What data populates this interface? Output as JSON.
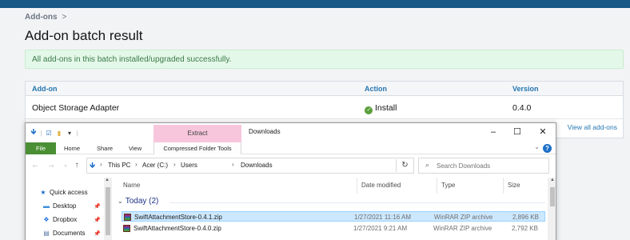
{
  "page": {
    "breadcrumb": "Add-ons",
    "breadcrumb_sep": ">",
    "title": "Add-on batch result",
    "success_message": "All add-ons in this batch installed/upgraded successfully.",
    "table": {
      "headers": {
        "addon": "Add-on",
        "action": "Action",
        "version": "Version"
      },
      "rows": [
        {
          "addon": "Object Storage Adapter",
          "action": "Install",
          "version": "0.4.0"
        }
      ]
    },
    "view_all_link": "View all add-ons"
  },
  "explorer": {
    "title": "Downloads",
    "contextual_tab": "Extract",
    "ribbon_tabs": {
      "file": "File",
      "home": "Home",
      "share": "Share",
      "view": "View",
      "compressed_tools": "Compressed Folder Tools"
    },
    "address": {
      "this_pc": "This PC",
      "drive": "Acer (C:)",
      "users": "Users",
      "folder": "Downloads"
    },
    "search_placeholder": "Search Downloads",
    "nav_items": {
      "quick_access": "Quick access",
      "desktop": "Desktop",
      "dropbox": "Dropbox",
      "documents": "Documents"
    },
    "columns": {
      "name": "Name",
      "date": "Date modified",
      "type": "Type",
      "size": "Size"
    },
    "group_label": "Today (2)",
    "files": [
      {
        "name": "SwiftAttachmentStore-0.4.1.zip",
        "date": "1/27/2021 11:16 AM",
        "type": "WinRAR ZIP archive",
        "size": "2,896 KB"
      },
      {
        "name": "SwiftAttachmentStore-0.4.0.zip",
        "date": "1/27/2021 9:21 AM",
        "type": "WinRAR ZIP archive",
        "size": "2,792 KB"
      }
    ]
  },
  "colors": {
    "topbar": "#185886",
    "link": "#2577b1",
    "success_bg": "#e4f8e9",
    "success_text": "#3b7a47",
    "selection": "#cce8ff",
    "extract_tab": "#f7c6dc",
    "file_tab": "#4b8f35"
  }
}
